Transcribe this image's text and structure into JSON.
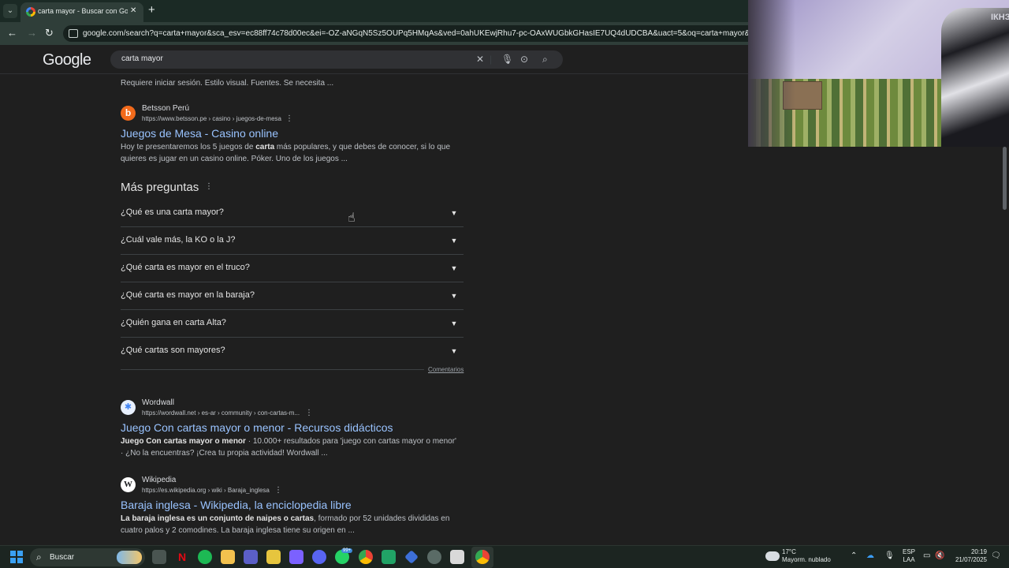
{
  "browser": {
    "tab_title": "carta mayor - Buscar con Google",
    "tab_close": "✕",
    "new_tab": "+",
    "url": "google.com/search?q=carta+mayor&sca_esv=ec88ff74c78d00ec&ei=-OZ-aNGqN5Sz5OUPq5HMqAs&ved=0ahUKEwjRhu7-pc-OAxWUGbkGHasIE7UQ4dUDCBA&uact=5&oq=carta+mayor&gs_lp=Egxnd3M"
  },
  "google": {
    "logo": [
      "G",
      "o",
      "o",
      "g",
      "l",
      "e"
    ],
    "logo_colors": [
      "#e8eaed",
      "#e8eaed",
      "#e8eaed",
      "#e8eaed",
      "#e8eaed",
      "#e8eaed"
    ],
    "query": "carta mayor"
  },
  "results": {
    "top_snippet": "Requiere iniciar sesión. Estilo visual. Fuentes. Se necesita ...",
    "betsson": {
      "site": "Betsson Perú",
      "url": "https://www.betsson.pe › casino › juegos-de-mesa",
      "title": "Juegos de Mesa - Casino online",
      "snippet_pre": "Hoy te presentaremos los 5 juegos de ",
      "snippet_bold": "carta",
      "snippet_post": " más populares, y que debes de conocer, si lo que quieres es jugar en un casino online. Póker. Uno de los juegos ..."
    },
    "paa": {
      "heading": "Más preguntas",
      "questions": [
        "¿Qué es una carta mayor?",
        "¿Cuál vale más, la KO o la J?",
        "¿Qué carta es mayor en el truco?",
        "¿Qué carta es mayor en la baraja?",
        "¿Quién gana en carta Alta?",
        "¿Qué cartas son mayores?"
      ],
      "feedback": "Comentarios"
    },
    "wordwall": {
      "site": "Wordwall",
      "url": "https://wordwall.net › es-ar › community › con-cartas-m...",
      "title": "Juego Con cartas mayor o menor - Recursos didácticos",
      "snippet_bold": "Juego Con cartas mayor o menor",
      "snippet_post": " · 10.000+ resultados para 'juego con cartas mayor o menor' · ¿No la encuentras? ¡Crea tu propia actividad! Wordwall ..."
    },
    "wikipedia": {
      "site": "Wikipedia",
      "url": "https://es.wikipedia.org › wiki › Baraja_inglesa",
      "title": "Baraja inglesa - Wikipedia, la enciclopedia libre",
      "snippet_bold": "La baraja inglesa es un conjunto de naipes o cartas",
      "snippet_post": ", formado por 52 unidades divididas en cuatro palos y 2 comodines. La baraja inglesa tiene su origen en ..."
    }
  },
  "webcam": {
    "tag": "ІКНЗ"
  },
  "taskbar": {
    "search_label": "Buscar",
    "whatsapp_badge": "99+",
    "weather_temp": "17°C",
    "weather_desc": "Mayorm. nublado",
    "lang_1": "ESP",
    "lang_2": "LAA",
    "time": "20:19",
    "date": "21/07/2025"
  },
  "colors": {
    "link": "#99c3ff",
    "background": "#1f1f1f",
    "chrome_frame": "#1b2a25"
  }
}
